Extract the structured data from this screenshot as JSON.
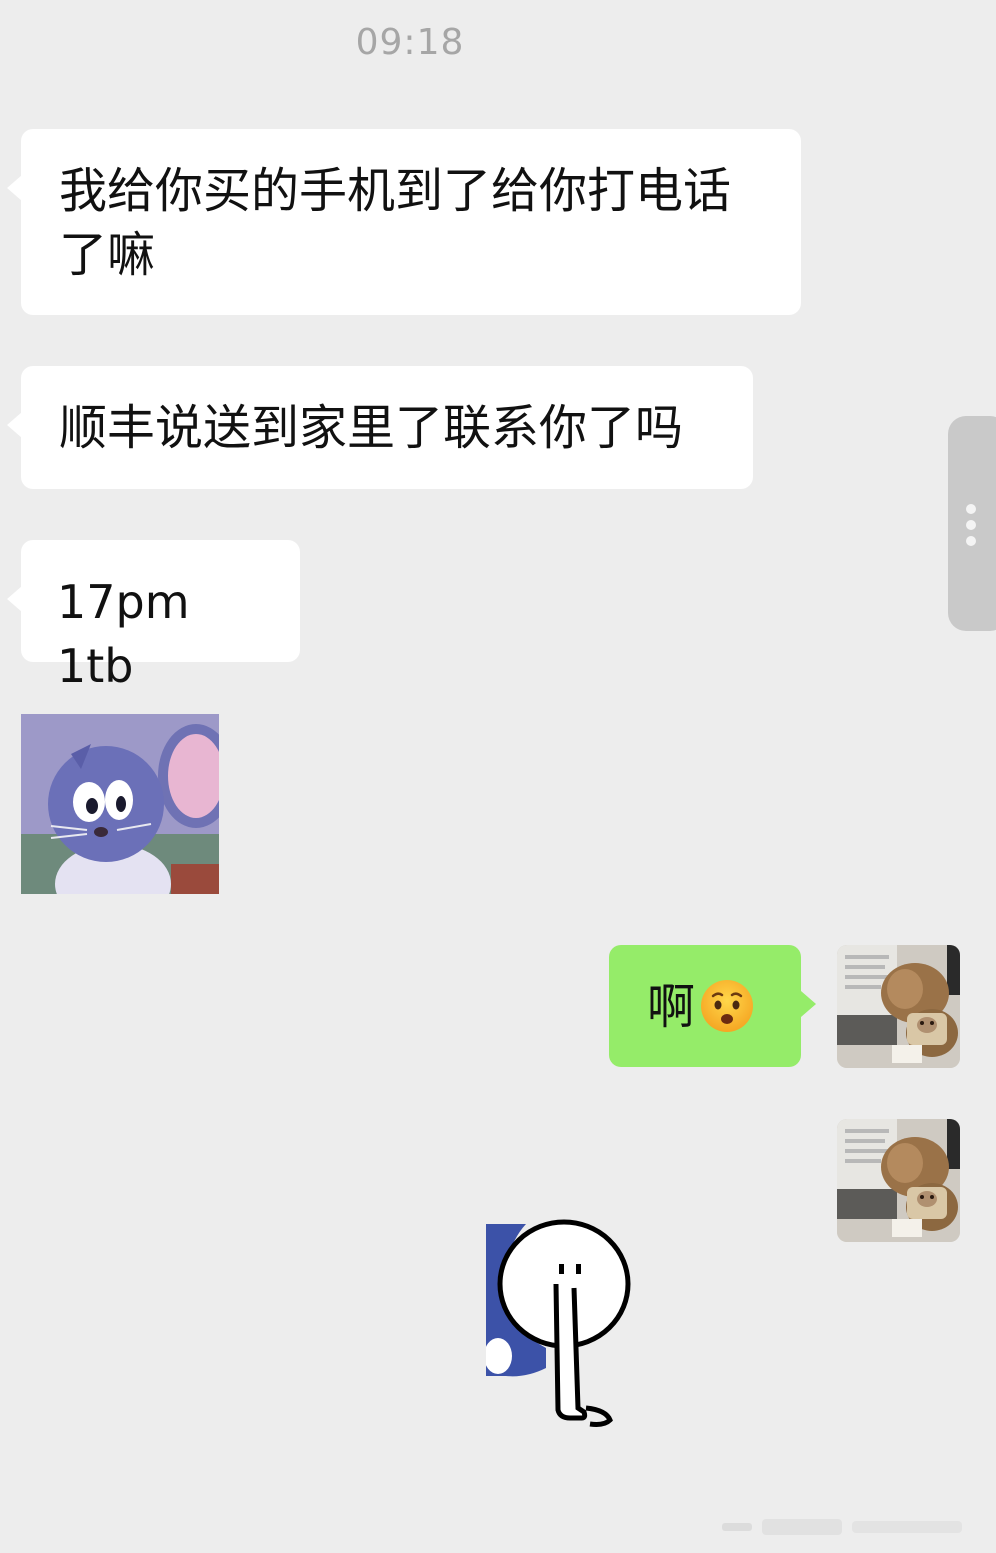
{
  "chat": {
    "timestamp": "09:18",
    "messages": [
      {
        "side": "incoming",
        "type": "text",
        "text": "我给你买的手机到了给你打电话了嘛"
      },
      {
        "side": "incoming",
        "type": "text",
        "text": "顺丰说送到家里了联系你了吗"
      },
      {
        "side": "incoming",
        "type": "text",
        "text": "17pm 1tb"
      },
      {
        "side": "incoming",
        "type": "sticker",
        "icon": "mouse-sticker"
      },
      {
        "side": "outgoing",
        "type": "text",
        "text": "啊",
        "emoji": "worried-face-emoji"
      },
      {
        "side": "outgoing",
        "type": "sticker",
        "icon": "stick-figure-sticker"
      }
    ]
  },
  "colors": {
    "background": "#ededed",
    "incoming_bubble": "#ffffff",
    "outgoing_bubble": "#95ec69",
    "timestamp_text": "#a6a6a6"
  }
}
